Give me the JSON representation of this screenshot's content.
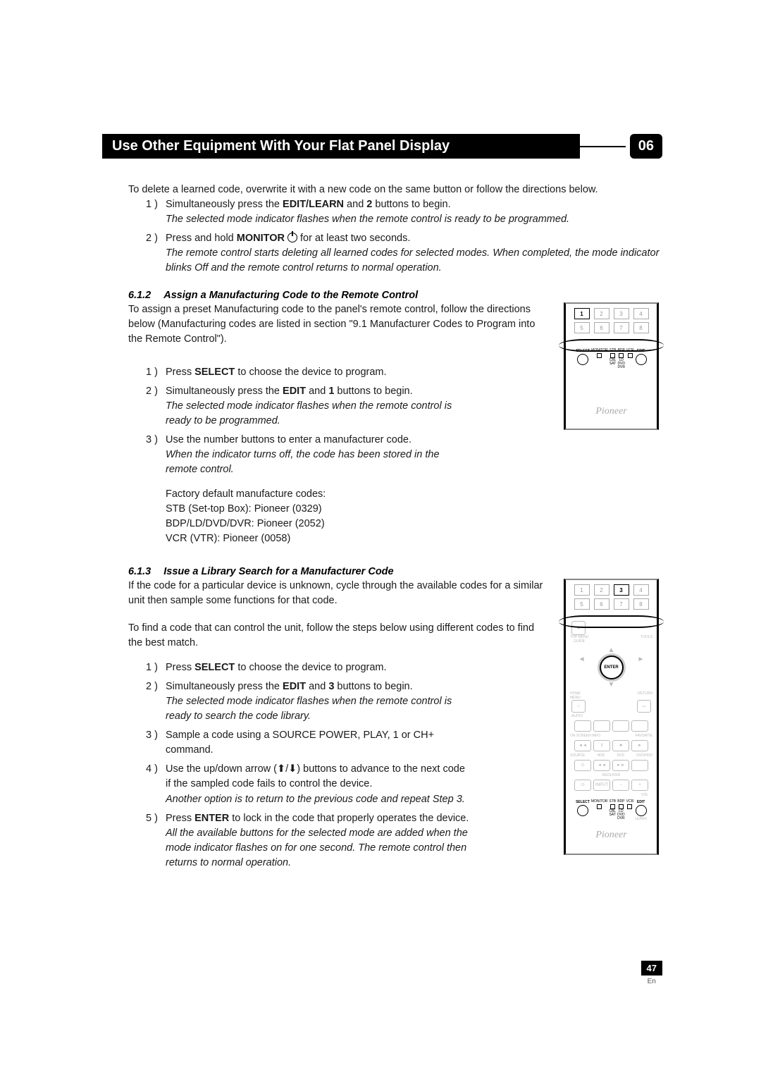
{
  "header": {
    "title": "Use Other Equipment With Your Flat Panel Display",
    "chapter_number": "06"
  },
  "intro_line": "To delete a learned code, overwrite it with a new code on the same button or follow the directions below.",
  "delete_steps": [
    {
      "marker": "1 )",
      "text_a": "Simultaneously press the ",
      "bold_a": "EDIT/LEARN",
      "text_b": " and ",
      "bold_b": "2",
      "text_c": " buttons to begin.",
      "italic": "The selected mode indicator flashes when the remote control is ready to be programmed."
    },
    {
      "marker": "2 )",
      "text_a": "Press and hold ",
      "bold_a": "MONITOR",
      "text_b": " ",
      "has_power_icon": true,
      "text_c": " for at least two seconds.",
      "italic": "The remote control starts deleting all learned codes for selected modes. When completed, the mode indicator blinks Off and the remote control returns to normal operation."
    }
  ],
  "section_612": {
    "num": "6.1.2",
    "title": "Assign a Manufacturing Code to the Remote Control",
    "intro": "To assign a preset Manufacturing code to the panel's remote control, follow the directions below (Manufacturing codes are listed in section \"9.1 Manufacturer Codes to Program into the Remote Control\").",
    "steps": [
      {
        "marker": "1 )",
        "text_a": "Press ",
        "bold_a": "SELECT",
        "text_b": " to choose the device to program."
      },
      {
        "marker": "2 )",
        "text_a": "Simultaneously press the ",
        "bold_a": "EDIT",
        "text_b": " and ",
        "bold_b": "1",
        "text_c": " buttons to begin.",
        "italic": "The selected mode indicator flashes when the remote control is ready to be programmed."
      },
      {
        "marker": "3 )",
        "text_a": "Use the number buttons to enter a manufacturer code.",
        "italic": "When the indicator turns off, the code has been stored in the remote control."
      }
    ],
    "factory": {
      "heading": "Factory default manufacture codes:",
      "l1": "STB (Set-top Box): Pioneer (0329)",
      "l2": "BDP/LD/DVD/DVR: Pioneer (2052)",
      "l3": "VCR (VTR): Pioneer (0058)"
    }
  },
  "section_613": {
    "num": "6.1.3",
    "title": "Issue a Library Search for a Manufacturer Code",
    "intro": "If the code for a particular device is unknown, cycle through the available codes for a similar unit then sample some functions for that code.",
    "intro2": "To find a code that can control the unit, follow the steps below using different codes to find the best match.",
    "steps": [
      {
        "marker": "1 )",
        "text_a": "Press ",
        "bold_a": "SELECT",
        "text_b": " to choose the device to program."
      },
      {
        "marker": "2 )",
        "text_a": "Simultaneously press the ",
        "bold_a": "EDIT",
        "text_b": " and ",
        "bold_b": "3",
        "text_c": " buttons to begin.",
        "italic": "The selected mode indicator flashes when the remote control is ready to search the code library."
      },
      {
        "marker": "3 )",
        "text_a": "Sample a code using a SOURCE POWER, PLAY, 1 or CH+ command."
      },
      {
        "marker": "4 )",
        "text_a": "Use the up/down arrow (",
        "has_arrows": true,
        "text_b": ") buttons to advance to the next code if the sampled code fails to control the device.",
        "italic": "Another option is to return to the previous code and repeat Step 3."
      },
      {
        "marker": "5 )",
        "text_a": "Press ",
        "bold_a": "ENTER",
        "text_b": " to lock in the code that properly operates the device.",
        "italic": "All the available buttons for the selected mode are added when the mode indicator flashes on for one second. The remote control then returns to normal operation."
      }
    ]
  },
  "remote1": {
    "logo": "Pioneer",
    "hi_button": "1",
    "labels": {
      "select": "SELECT",
      "monitor": "MONITOR",
      "stb": "STB",
      "bdp": "BDP",
      "vcr": "VCR",
      "edit": "EDIT"
    },
    "tiny": {
      "cbl": "CBL",
      "sat": "SAT",
      "ld": "LD",
      "dvd": "DVD",
      "dvr": "DVR"
    }
  },
  "remote2": {
    "logo": "Pioneer",
    "hi_button": "3",
    "enter": "ENTER",
    "labels": {
      "topmenu": "TOP MENU\nGUIDE",
      "tools": "TOOLS",
      "homemenu": "HOME\nMENU",
      "return": "RETURN",
      "audio": "AUDIO",
      "onscreen": "ON SCREEN INFO",
      "favorite": "FAVORITE",
      "source": "SOURCE",
      "hdd": "HDD",
      "dvd_label": "DVD",
      "hdd_dvd": "DVD/HDD",
      "receiver": "RECEIVER",
      "input": "INPUT",
      "vol": "VOL",
      "select": "SELECT",
      "monitor": "MONITOR",
      "stb": "STB",
      "bdp": "BDP",
      "vcr": "VCR",
      "edit": "EDIT",
      "cbl": "CBL",
      "sat": "SAT",
      "ld": "LD",
      "dvd2": "DVD",
      "dvr": "DVR",
      "learn": "LEARN"
    },
    "transport": {
      "rew": "◄◄",
      "play": "►",
      "pause": "II",
      "ff": "►►"
    }
  },
  "page": {
    "number": "47",
    "lang": "En"
  },
  "numpad": [
    "1",
    "2",
    "3",
    "4",
    "5",
    "6",
    "7",
    "8"
  ]
}
